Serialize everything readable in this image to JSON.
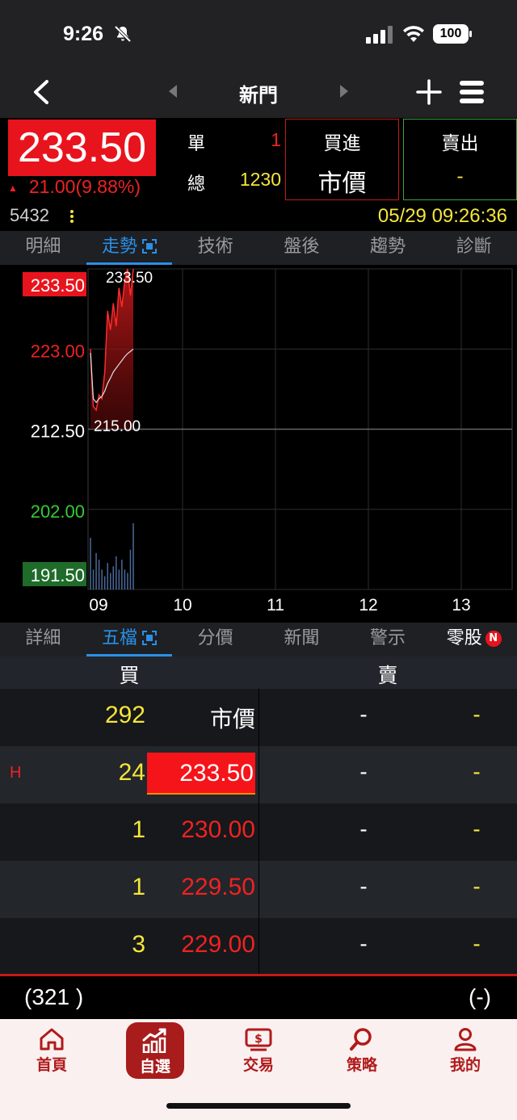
{
  "status": {
    "time": "9:26",
    "battery": "100"
  },
  "nav": {
    "title": "新門"
  },
  "quote": {
    "price": "233.50",
    "change": "21.00(9.88%)",
    "single_label": "單",
    "single_value": "1",
    "total_label": "總",
    "total_value": "1230",
    "buy_label": "買進",
    "buy_value": "市價",
    "sell_label": "賣出",
    "sell_value": "-",
    "code": "5432",
    "timestamp": "05/29 09:26:36"
  },
  "chart_tabs": [
    {
      "label": "明細",
      "active": false
    },
    {
      "label": "走勢",
      "active": true
    },
    {
      "label": "技術",
      "active": false
    },
    {
      "label": "盤後",
      "active": false
    },
    {
      "label": "趨勢",
      "active": false
    },
    {
      "label": "診斷",
      "active": false
    }
  ],
  "chart_data": {
    "type": "line",
    "title": "",
    "y_ticks": [
      "233.50",
      "223.00",
      "212.50",
      "202.00",
      "191.50"
    ],
    "ylim": [
      191.5,
      233.5
    ],
    "reference_price": 212.5,
    "x_ticks": [
      "09",
      "10",
      "11",
      "12",
      "13"
    ],
    "high_label": "233.50",
    "low_label": "215.00",
    "series": [
      {
        "values": [
          223.0,
          215.5,
          215.0,
          217.0,
          216.5,
          220.0,
          228.0,
          225.5,
          229.0,
          226.0,
          231.0,
          228.5,
          232.0,
          233.5,
          230.0,
          233.5
        ]
      },
      {
        "values": [
          222.5,
          216.5,
          216.0,
          216.5,
          216.8,
          217.5,
          218.5,
          219.2,
          220.0,
          220.5,
          221.0,
          221.5,
          222.0,
          222.4,
          222.7,
          223.0
        ]
      }
    ],
    "volume": [
      0.78,
      0.3,
      0.55,
      0.45,
      0.3,
      0.2,
      0.4,
      0.25,
      0.35,
      0.5,
      0.3,
      0.45,
      0.3,
      0.25,
      0.6,
      1.0
    ]
  },
  "book_tabs": [
    {
      "label": "詳細",
      "active": false
    },
    {
      "label": "五檔",
      "active": true
    },
    {
      "label": "分價",
      "active": false
    },
    {
      "label": "新聞",
      "active": false
    },
    {
      "label": "警示",
      "active": false
    },
    {
      "label": "零股",
      "active": false,
      "badge": "N"
    }
  ],
  "order_book": {
    "buy_header": "買",
    "sell_header": "賣",
    "rows": [
      {
        "mark": "",
        "bid_qty": "292",
        "bid_price": "市價",
        "ask_price": "-",
        "ask_qty": "-"
      },
      {
        "mark": "H",
        "bid_qty": "24",
        "bid_price": "233.50",
        "ask_price": "-",
        "ask_qty": "-"
      },
      {
        "mark": "",
        "bid_qty": "1",
        "bid_price": "230.00",
        "ask_price": "-",
        "ask_qty": "-"
      },
      {
        "mark": "",
        "bid_qty": "1",
        "bid_price": "229.50",
        "ask_price": "-",
        "ask_qty": "-"
      },
      {
        "mark": "",
        "bid_qty": "3",
        "bid_price": "229.00",
        "ask_price": "-",
        "ask_qty": "-"
      }
    ],
    "bid_total": "(321 )",
    "ask_total": "(-)"
  },
  "bottom_nav": [
    {
      "label": "首頁",
      "icon": "home-icon",
      "active": false
    },
    {
      "label": "自選",
      "icon": "watchlist-chart-icon",
      "active": true
    },
    {
      "label": "交易",
      "icon": "trade-icon",
      "active": false
    },
    {
      "label": "策略",
      "icon": "search-icon",
      "active": false
    },
    {
      "label": "我的",
      "icon": "user-icon",
      "active": false
    }
  ]
}
